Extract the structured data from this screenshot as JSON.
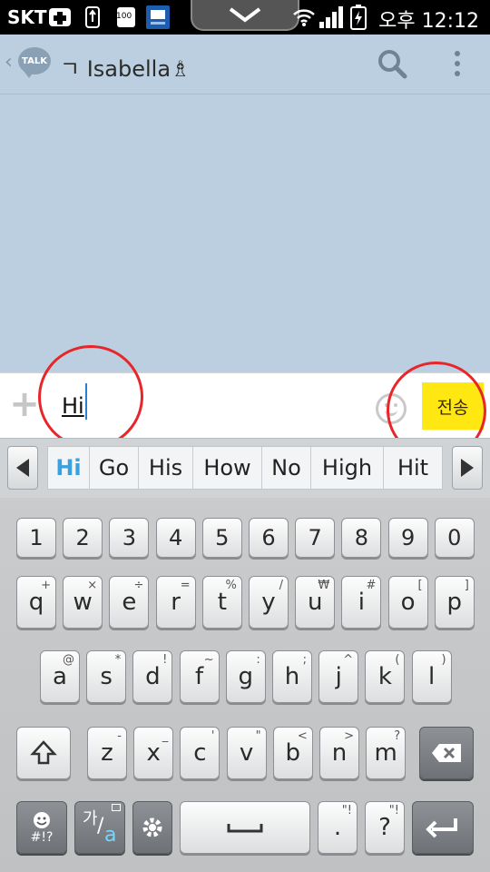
{
  "status_bar": {
    "carrier": "SKT",
    "icons": [
      "medical-cross-icon",
      "usb-icon",
      "battery-100-icon",
      "news-app-icon",
      "pull-down-chevron-icon",
      "wifi-icon",
      "signal-icon",
      "battery-charging-icon"
    ],
    "battery_small_label": "100",
    "time": "오후 12:12"
  },
  "header": {
    "app_logo": "TALK",
    "title": "ㄱ Isabella♗",
    "icons": [
      "back-chevron-icon",
      "search-icon",
      "overflow-menu-icon"
    ]
  },
  "input_bar": {
    "add_icon": "+",
    "message_value": "Hi",
    "send_label": "전송",
    "icons": [
      "plus-icon",
      "emoticon-icon"
    ]
  },
  "suggestions": {
    "items": [
      "Hi",
      "Go",
      "His",
      "How",
      "No",
      "High",
      "Hit"
    ]
  },
  "keyboard": {
    "number_row": [
      "1",
      "2",
      "3",
      "4",
      "5",
      "6",
      "7",
      "8",
      "9",
      "0"
    ],
    "row1": [
      {
        "key": "q",
        "sub": "+"
      },
      {
        "key": "w",
        "sub": "×"
      },
      {
        "key": "e",
        "sub": "÷"
      },
      {
        "key": "r",
        "sub": "="
      },
      {
        "key": "t",
        "sub": "%"
      },
      {
        "key": "y",
        "sub": "/"
      },
      {
        "key": "u",
        "sub": "₩"
      },
      {
        "key": "i",
        "sub": "#"
      },
      {
        "key": "o",
        "sub": "["
      },
      {
        "key": "p",
        "sub": "]"
      }
    ],
    "row2": [
      {
        "key": "a",
        "sub": "@"
      },
      {
        "key": "s",
        "sub": "*"
      },
      {
        "key": "d",
        "sub": "!"
      },
      {
        "key": "f",
        "sub": "~"
      },
      {
        "key": "g",
        "sub": ":"
      },
      {
        "key": "h",
        "sub": ";"
      },
      {
        "key": "j",
        "sub": "^"
      },
      {
        "key": "k",
        "sub": "("
      },
      {
        "key": "l",
        "sub": ")"
      }
    ],
    "row3": [
      {
        "key": "z",
        "sub": "-"
      },
      {
        "key": "x",
        "sub": "_"
      },
      {
        "key": "c",
        "sub": "'"
      },
      {
        "key": "v",
        "sub": "\""
      },
      {
        "key": "b",
        "sub": "<"
      },
      {
        "key": "n",
        "sub": ">"
      },
      {
        "key": "m",
        "sub": "?"
      }
    ],
    "bottom": {
      "symbols_label": "#!?",
      "lang_label_top": "가",
      "lang_label_bottom": "a",
      "period": ".",
      "question": "?",
      "period_sub": "\"!",
      "question_sub": "\"!"
    }
  },
  "colors": {
    "chat_bg": "#bccfe0",
    "send_yellow": "#ffe811",
    "suggestion_highlight": "#3aa0e0",
    "annotation_red": "#e8262a"
  }
}
